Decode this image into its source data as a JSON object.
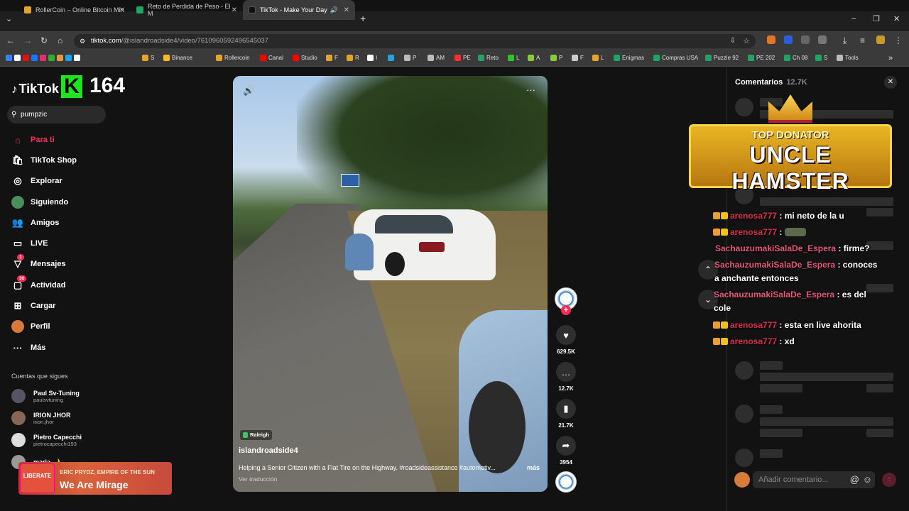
{
  "browser": {
    "tabs": [
      {
        "title": "RollerCoin – Online Bitcoin Min",
        "active": false
      },
      {
        "title": "Reto de Perdida de Peso - El M",
        "active": false
      },
      {
        "title": "TikTok - Make Your Day",
        "active": true
      }
    ],
    "url_host": "tiktok.com",
    "url_path": "/@islandroadside4/video/7610960592496545037",
    "bookmarks": [
      "S",
      "Binance",
      "Rollercoin",
      "Canal",
      "Studio",
      "F",
      "R",
      "I",
      "P",
      "AM",
      "PE",
      "Reto",
      "L",
      "A",
      "P",
      "F",
      "L",
      "Enigmas",
      "Compras USA",
      "Puzzle 92",
      "PE 202",
      "Ch 08",
      "S",
      "Tools"
    ]
  },
  "tiktok": {
    "logo": "TikTok",
    "kick_letter": "K",
    "kick_count": "164",
    "search_value": "pumpzic",
    "nav": [
      {
        "label": "Para ti",
        "icon": "home-icon",
        "active": true
      },
      {
        "label": "TikTok Shop",
        "icon": "shop-icon"
      },
      {
        "label": "Explorar",
        "icon": "compass-icon"
      },
      {
        "label": "Siguiendo",
        "icon": "following-icon"
      },
      {
        "label": "Amigos",
        "icon": "friends-icon"
      },
      {
        "label": "LIVE",
        "icon": "live-icon"
      },
      {
        "label": "Mensajes",
        "icon": "messages-icon",
        "badge": "1"
      },
      {
        "label": "Actividad",
        "icon": "activity-icon",
        "badge": "36"
      },
      {
        "label": "Cargar",
        "icon": "upload-icon"
      },
      {
        "label": "Perfil",
        "icon": "profile-icon"
      },
      {
        "label": "Más",
        "icon": "more-icon"
      }
    ],
    "following_title": "Cuentas que sigues",
    "following": [
      {
        "name": "Paul Sv-Tuning",
        "handle": "paulsvtuning"
      },
      {
        "name": "IRION JHOR",
        "handle": "irion.jhor"
      },
      {
        "name": "Pietro Capecchi",
        "handle": "pietrocapecchi193"
      },
      {
        "name": "maria 🌙",
        "handle": ""
      }
    ]
  },
  "now_playing": {
    "art_text": "LIBERATE",
    "artist": "ERIC PRYDZ, EMPIRE OF THE SUN",
    "song": "We Are Mirage"
  },
  "video": {
    "location": "Raleigh",
    "author": "islandroadside4",
    "description": "Helping a Senior Citizen with a Flat Tire on the Highway. #roadsideassistance #automotiv...",
    "more_label": "más",
    "translate_label": "Ver traducción",
    "likes": "629.5K",
    "comments": "12.7K",
    "saves": "21.7K",
    "shares": "3954"
  },
  "comments_panel": {
    "title": "Comentarios",
    "count": "12.7K",
    "input_placeholder": "Añadir comentario..."
  },
  "overlay": {
    "donor_label": "TOP DONATOR",
    "donor_name": "UNCLE HAMSTER",
    "chat": [
      {
        "user": "arenosa777",
        "text": ": mi neto de la u",
        "icons": true
      },
      {
        "user": "arenosa777",
        "text": ":",
        "icons": true,
        "emote": true
      },
      {
        "user": "SachauzumakiSalaDe_Espera",
        "text": ": firme?",
        "icons": false
      },
      {
        "user": "SachauzumakiSalaDe_Espera",
        "text": ": conoces a anchante entonces",
        "icons": false
      },
      {
        "user": "SachauzumakiSalaDe_Espera",
        "text": ": es del cole",
        "icons": false
      },
      {
        "user": "arenosa777",
        "text": ": esta en live ahorita",
        "icons": true
      },
      {
        "user": "arenosa777",
        "text": ": xd",
        "icons": true
      }
    ]
  }
}
